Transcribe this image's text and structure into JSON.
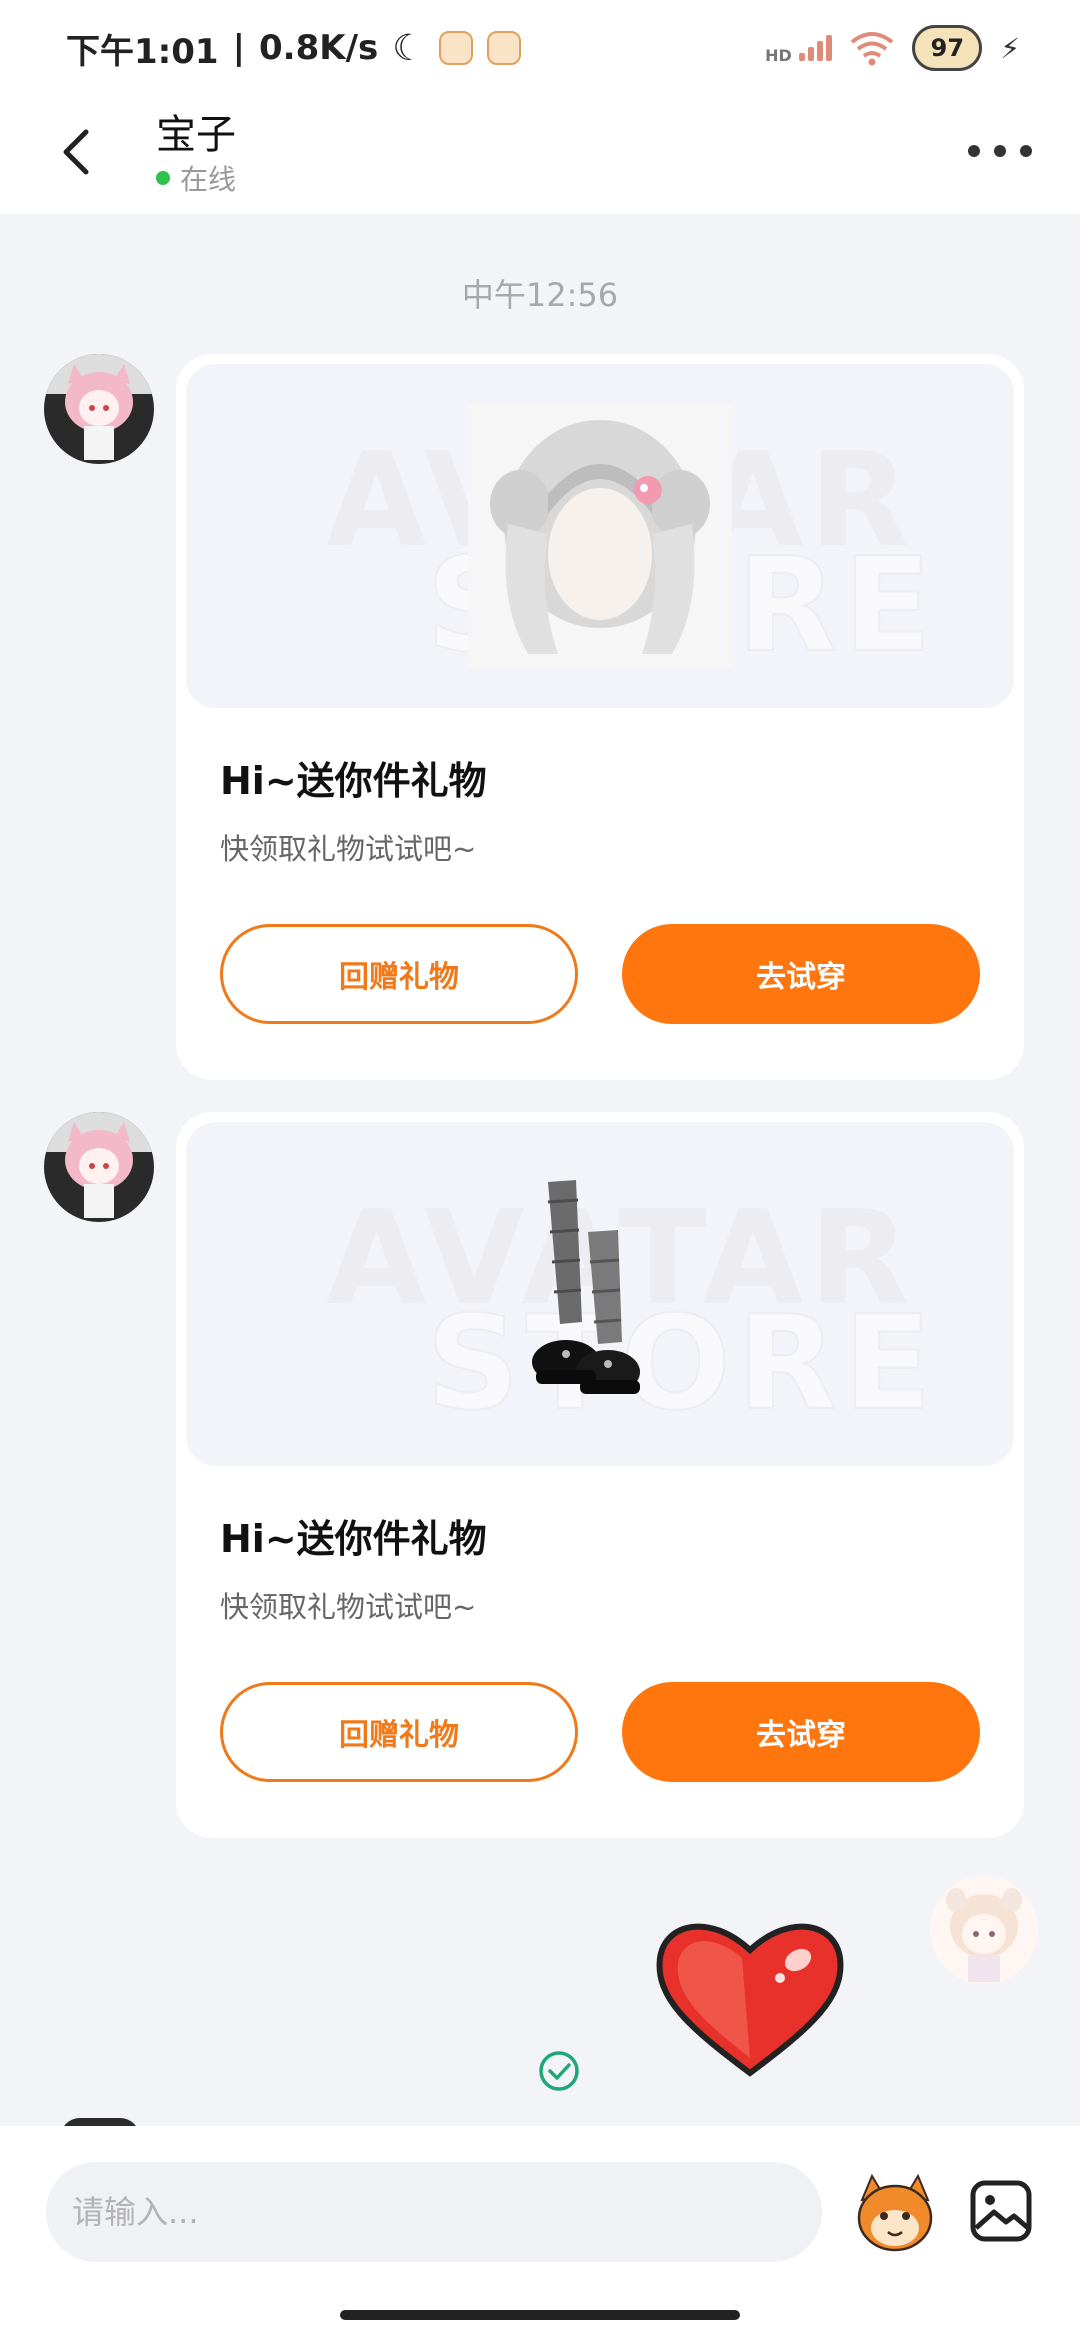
{
  "status_bar": {
    "time": "下午1:01",
    "net_speed": "0.8K/s",
    "network_label": "HD",
    "battery": "97"
  },
  "header": {
    "contact_name": "宝子",
    "presence": "在线"
  },
  "chat": {
    "timestamp": "中午12:56",
    "messages": [
      {
        "title": "Hi~送你件礼物",
        "subtitle": "快领取礼物试试吧~",
        "return_gift_label": "回赠礼物",
        "try_on_label": "去试穿",
        "watermark_top": "AVATAR",
        "watermark_bottom": "STORE"
      },
      {
        "title": "Hi~送你件礼物",
        "subtitle": "快领取礼物试试吧~",
        "return_gift_label": "回赠礼物",
        "try_on_label": "去试穿",
        "watermark_top": "AVATAR",
        "watermark_bottom": "STORE"
      }
    ]
  },
  "composer": {
    "placeholder": "请输入..."
  },
  "colors": {
    "accent": "#ff760e",
    "online": "#2ec24c",
    "background": "#f3f4f8"
  },
  "icons": [
    "back-icon",
    "more-icon",
    "heart-sticker",
    "read-check-icon",
    "sticker-icon",
    "image-icon"
  ]
}
